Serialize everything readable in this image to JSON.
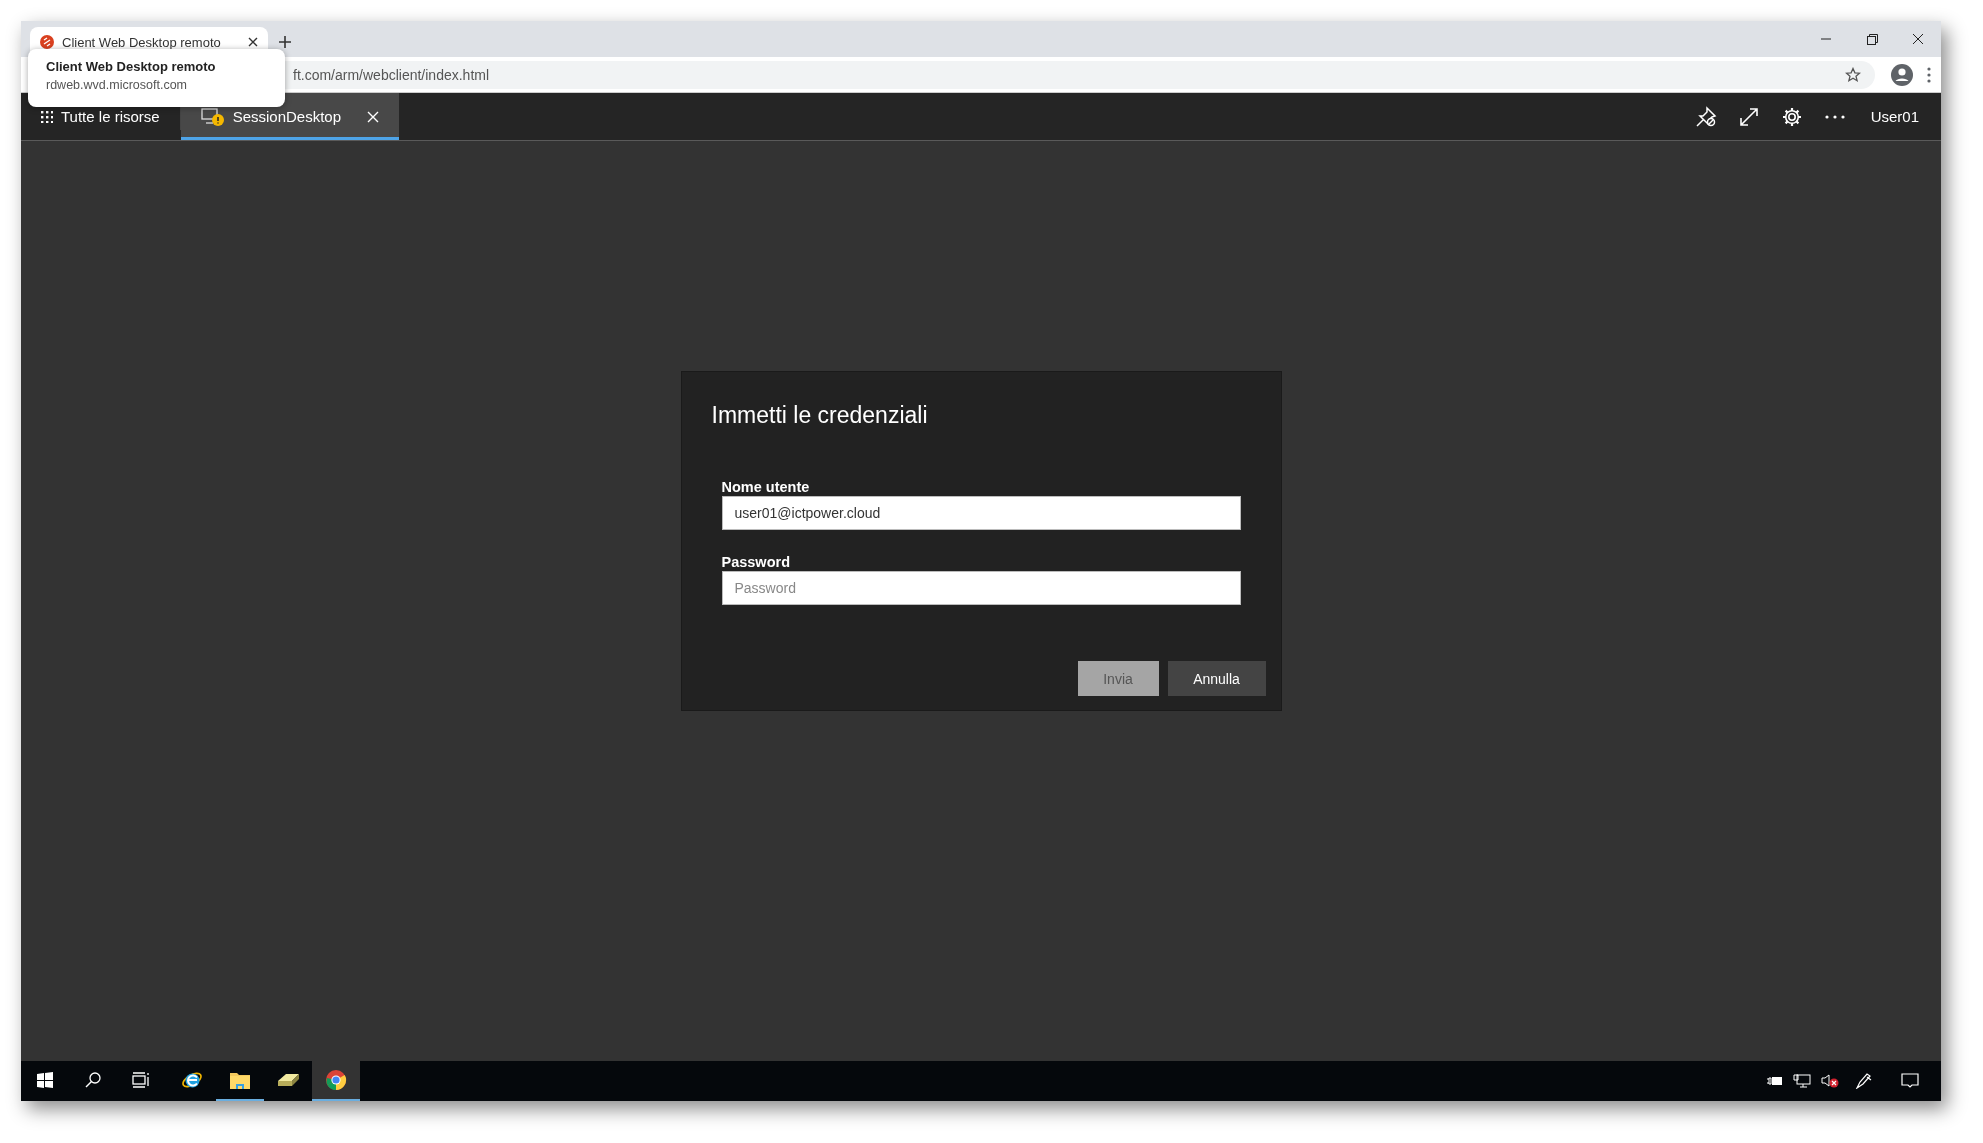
{
  "browser": {
    "tab": {
      "title": "Client Web Desktop remoto",
      "selected": true
    },
    "url_visible": "ft.com/arm/webclient/index.html",
    "tooltip": {
      "title": "Client Web Desktop remoto",
      "url": "rdweb.wvd.microsoft.com"
    }
  },
  "app_bar": {
    "tabs": [
      {
        "label": "Tutte le risorse",
        "selected": false,
        "kind": "all"
      },
      {
        "label": "SessionDesktop",
        "selected": true,
        "kind": "session"
      }
    ],
    "user": "User01"
  },
  "dialog": {
    "title": "Immetti le credenziali",
    "fields": [
      {
        "label": "Nome utente",
        "value": "user01@ictpower.cloud"
      },
      {
        "label": "Password",
        "placeholder": "Password"
      }
    ],
    "buttons": [
      {
        "label": "Invia",
        "disabled": true
      },
      {
        "label": "Annulla",
        "disabled": false
      }
    ]
  },
  "taskbar": {
    "apps": [
      {
        "kind": "ie",
        "running": false,
        "active": false
      },
      {
        "kind": "explorer",
        "running": true,
        "active": false
      },
      {
        "kind": "tool",
        "running": false,
        "active": false
      },
      {
        "kind": "chrome",
        "running": true,
        "active": true
      }
    ]
  }
}
